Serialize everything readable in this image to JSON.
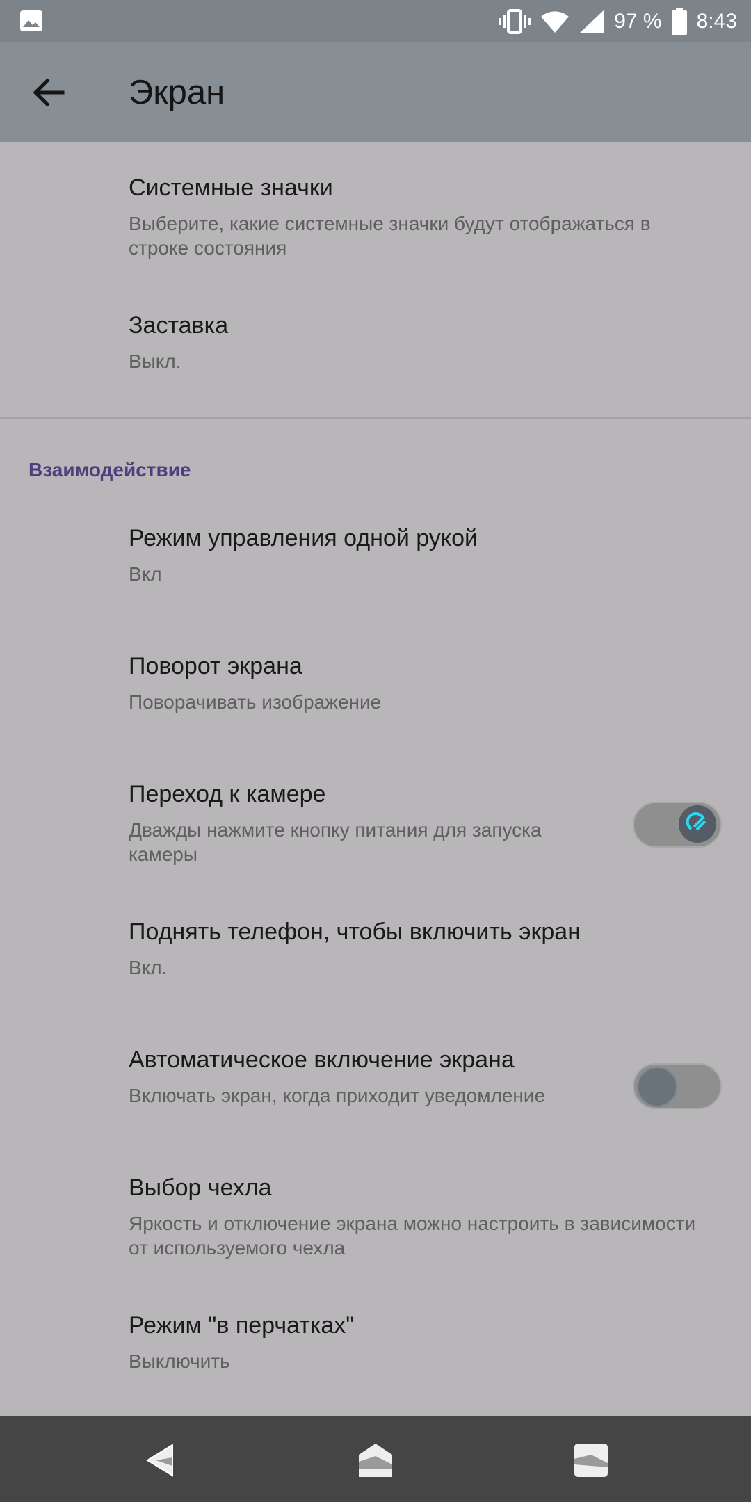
{
  "status_bar": {
    "battery_percent": "97 %",
    "time": "8:43",
    "icons": [
      "gallery-icon",
      "vibrate-icon",
      "wifi-icon",
      "signal-icon",
      "battery-icon"
    ]
  },
  "header": {
    "title": "Экран",
    "back_icon": "arrow-left-icon"
  },
  "settings_top": [
    {
      "title": "Системные значки",
      "subtitle": "Выберите, какие системные значки будут отображаться в строке состояния"
    },
    {
      "title": "Заставка",
      "subtitle": "Выкл."
    }
  ],
  "interaction": {
    "section_title": "Взаимодействие",
    "items": [
      {
        "title": "Режим управления одной рукой",
        "subtitle": "Вкл"
      },
      {
        "title": "Поворот экрана",
        "subtitle": "Поворачивать изображение"
      },
      {
        "title": "Переход к камере",
        "subtitle": "Дважды нажмите кнопку питания для запуска камеры",
        "toggle": true
      },
      {
        "title": "Поднять телефон, чтобы включить экран",
        "subtitle": "Вкл."
      },
      {
        "title": "Автоматическое включение экрана",
        "subtitle": "Включать экран, когда приходит уведомление",
        "toggle": false
      },
      {
        "title": "Выбор чехла",
        "subtitle": "Яркость и отключение экрана можно настроить в зависимости от используемого чехла"
      },
      {
        "title": "Режим \"в перчатках\"",
        "subtitle": "Выключить"
      }
    ]
  },
  "nav_bar": {
    "icons": [
      "nav-back-icon",
      "nav-home-icon",
      "nav-recents-icon"
    ]
  },
  "colors": {
    "accent": "#4b3f7e",
    "toggle_on_thumb": "#2ad8f0",
    "background": "#b8b6b8"
  }
}
